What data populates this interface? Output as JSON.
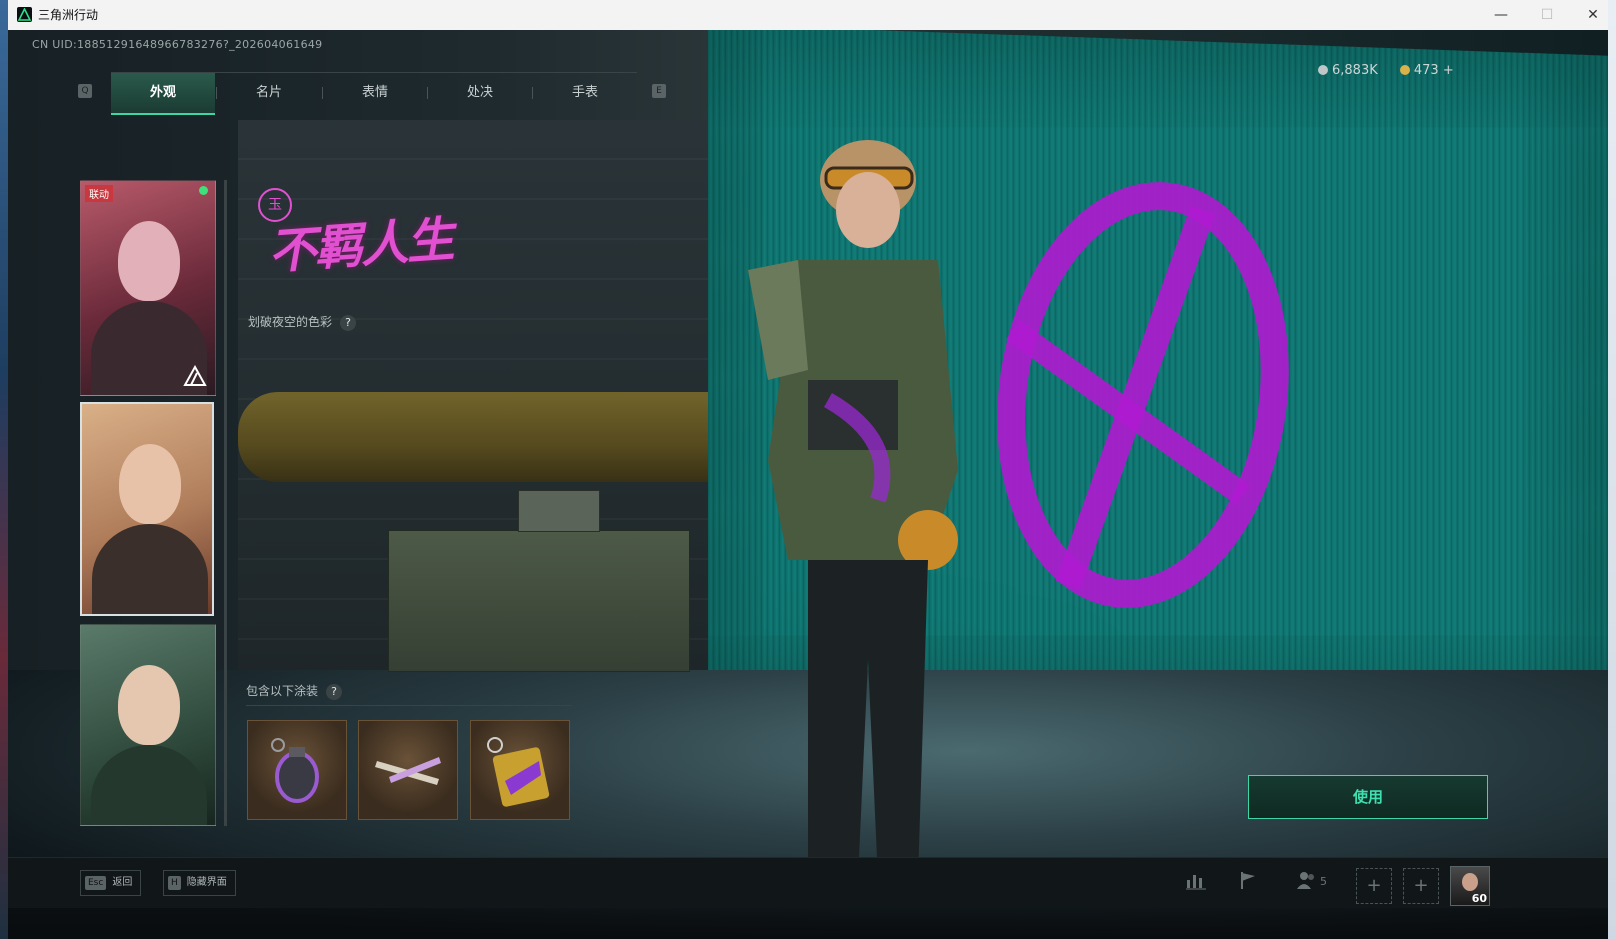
{
  "window": {
    "title": "三角洲行动",
    "minimize": "—",
    "maximize": "☐",
    "close": "✕"
  },
  "uid": "CN UID:18851291648966783276?_202604061649",
  "currency": {
    "silver": "6,883K",
    "gold": "473 +"
  },
  "tab_keys": {
    "prev": "Q",
    "next": "E"
  },
  "tabs": [
    {
      "label": "外观"
    },
    {
      "label": "名片"
    },
    {
      "label": "表情"
    },
    {
      "label": "处决"
    },
    {
      "label": "手表"
    }
  ],
  "skins": {
    "badge": "联动"
  },
  "skin": {
    "title": "不羁人生",
    "seal": "玉",
    "description": "划破夜空的色彩",
    "contains_label": "包含以下涂装"
  },
  "help_glyph": "?",
  "use_button": "使用",
  "hints": {
    "esc_key": "Esc",
    "esc_label": "返回",
    "hide_key": "H",
    "hide_label": "隐藏界面"
  },
  "squad_count": "5",
  "slot_glyph": "+",
  "player": {
    "level": "60"
  },
  "colors": {
    "accent": "#3fd6a6",
    "skin_magenta": "#e050d0",
    "badge_red": "#c8383e"
  }
}
